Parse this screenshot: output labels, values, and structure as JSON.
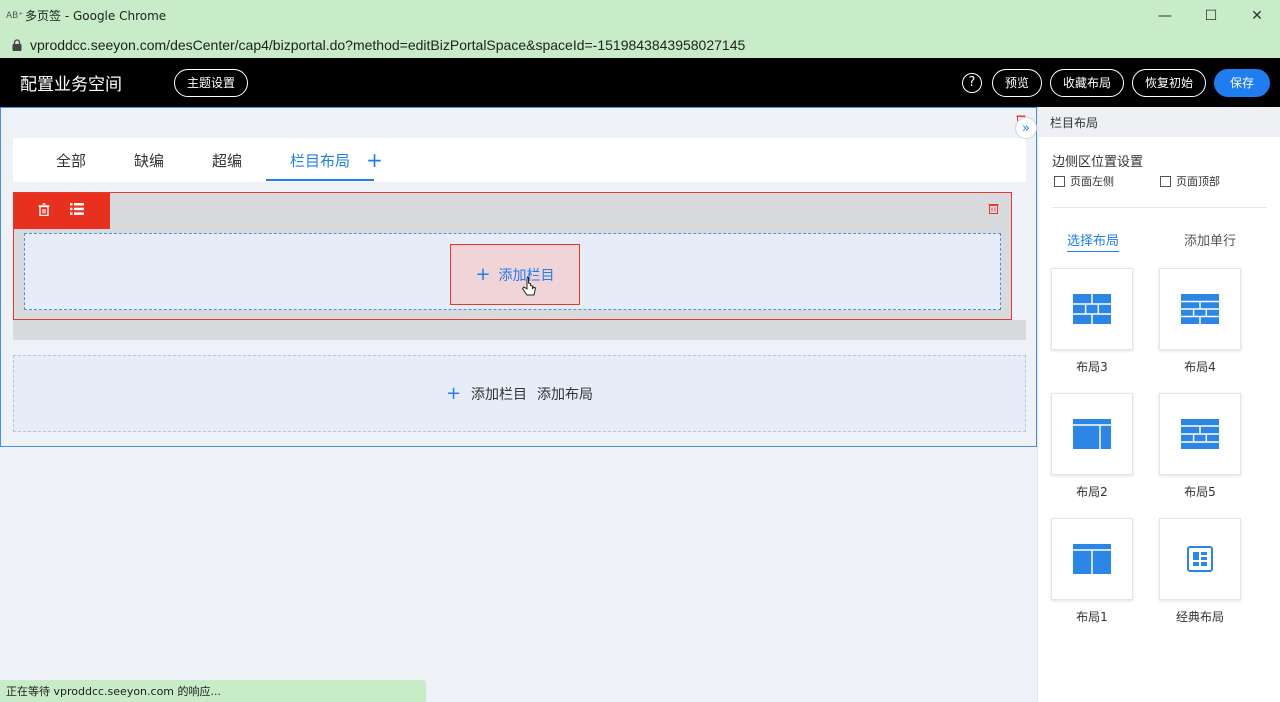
{
  "window": {
    "app_icon_text": "AB⁺",
    "title": "多页签 - Google Chrome",
    "url": "vproddcc.seeyon.com/desCenter/cap4/bizportal.do?method=editBizPortalSpace&spaceId=-1519843843958027145",
    "minimize": "—",
    "maximize": "☐",
    "close": "✕"
  },
  "header": {
    "title": "配置业务空间",
    "theme_button": "主题设置",
    "help": "?",
    "preview_button": "预览",
    "favorite_layout_button": "收藏布局",
    "restore_button": "恢复初始",
    "save_button": "保存"
  },
  "tabs": {
    "items": [
      "全部",
      "缺编",
      "超编",
      "栏目布局"
    ],
    "active_index": 3,
    "add": "+"
  },
  "section": {
    "add_column_button": "添加栏目",
    "plus": "+"
  },
  "add_area": {
    "plus": "+",
    "add_column": "添加栏目",
    "add_layout": "添加布局"
  },
  "right_panel": {
    "header": "栏目布局",
    "collapse": "»",
    "side_title": "边侧区位置设置",
    "checkbox_left": "页面左侧",
    "checkbox_top": "页面顶部",
    "tab_select_layout": "选择布局",
    "tab_add_row": "添加单行",
    "layouts": [
      "布局3",
      "布局4",
      "布局2",
      "布局5",
      "布局1",
      "经典布局"
    ]
  },
  "status": {
    "text": "正在等待 vproddcc.seeyon.com 的响应..."
  },
  "colors": {
    "accent": "#1e7ef0",
    "danger": "#e8301f",
    "chrome_bar": "#c8ebc8",
    "app_header": "#000000"
  }
}
